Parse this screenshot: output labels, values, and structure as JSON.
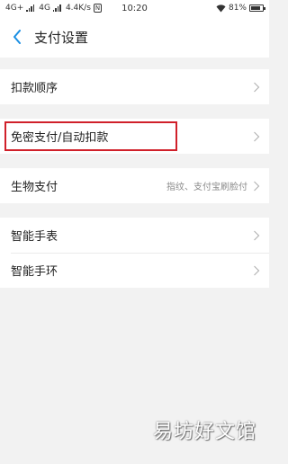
{
  "status_bar": {
    "signal1": "4G+",
    "signal2": "4G",
    "net_speed": "4.4K/s",
    "nfc_badge": "N",
    "time": "10:20",
    "battery_percent": "81%",
    "battery_level": 0.81
  },
  "nav": {
    "title": "支付设置"
  },
  "settings": {
    "deduction_order": {
      "label": "扣款顺序"
    },
    "password_free": {
      "label": "免密支付/自动扣款"
    },
    "biometric": {
      "label": "生物支付",
      "value": "指纹、支付宝刷脸付"
    },
    "smart_watch": {
      "label": "智能手表"
    },
    "smart_band": {
      "label": "智能手环"
    }
  },
  "colors": {
    "highlight": "#d0202a",
    "accent": "#1a8fe3"
  },
  "watermark": "易坊好文馆"
}
